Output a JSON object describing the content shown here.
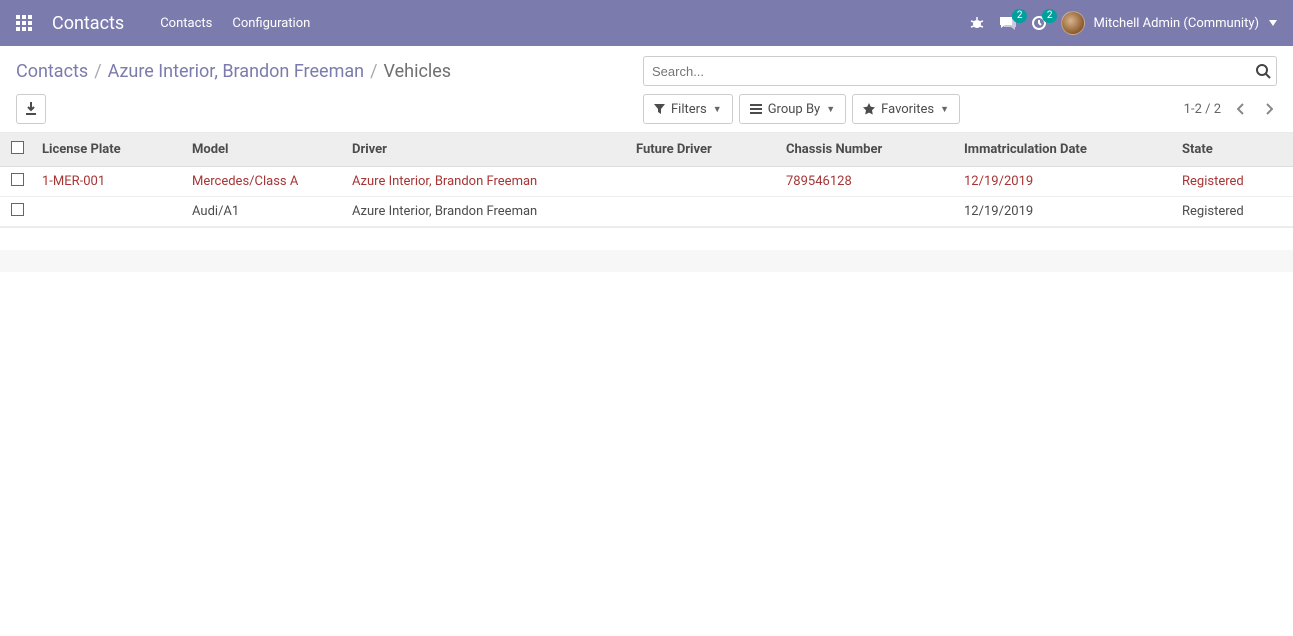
{
  "navbar": {
    "brand": "Contacts",
    "menu": [
      "Contacts",
      "Configuration"
    ],
    "chat_count": "2",
    "activity_count": "2",
    "user_label": "Mitchell Admin (Community)"
  },
  "breadcrumb": {
    "root": "Contacts",
    "parent": "Azure Interior, Brandon Freeman",
    "current": "Vehicles",
    "sep": "/"
  },
  "search": {
    "placeholder": "Search..."
  },
  "buttons": {
    "filters": "Filters",
    "groupby": "Group By",
    "favorites": "Favorites"
  },
  "pager": {
    "range": "1-2 / 2"
  },
  "table": {
    "headers": [
      "License Plate",
      "Model",
      "Driver",
      "Future Driver",
      "Chassis Number",
      "Immatriculation Date",
      "State"
    ],
    "rows": [
      {
        "license": "1-MER-001",
        "model": "Mercedes/Class A",
        "driver": "Azure Interior, Brandon Freeman",
        "future": "",
        "chassis": "789546128",
        "immat": "12/19/2019",
        "state": "Registered",
        "highlight": true
      },
      {
        "license": "",
        "model": "Audi/A1",
        "driver": "Azure Interior, Brandon Freeman",
        "future": "",
        "chassis": "",
        "immat": "12/19/2019",
        "state": "Registered",
        "highlight": false
      }
    ]
  }
}
